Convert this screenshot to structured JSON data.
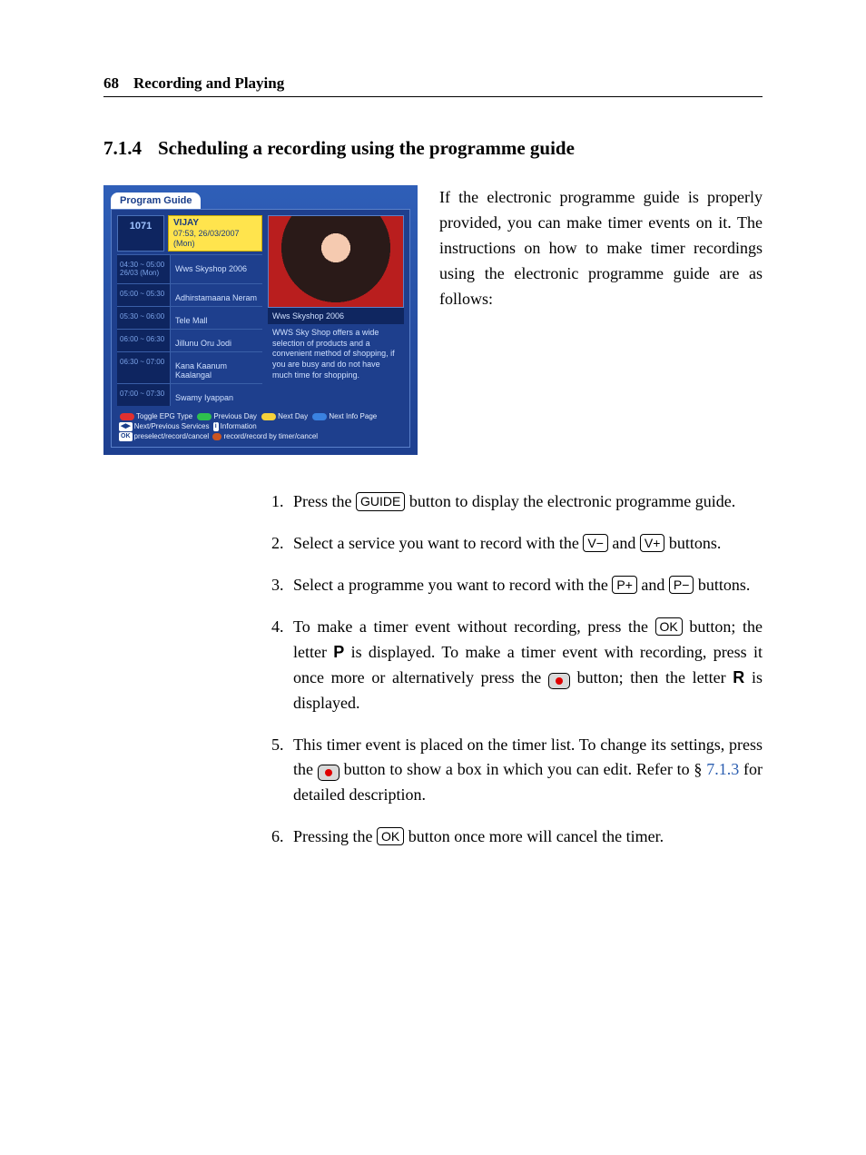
{
  "header": {
    "page_number": "68",
    "chapter_title": "Recording and Playing"
  },
  "section": {
    "number": "7.1.4",
    "title": "Scheduling a recording using the programme guide"
  },
  "intro_paragraph": "If the electronic programme guide is properly provided, you can make timer events on it. The instructions on how to make timer recordings using the electronic programme guide are as follows:",
  "epg": {
    "tab_title": "Program Guide",
    "channel_number": "1071",
    "channel_name": "VIJAY",
    "datetime": "07:53, 26/03/2007 (Mon)",
    "rows": [
      {
        "time": "04:30 ~ 05:00",
        "time_note": "26/03 (Mon)",
        "programme": "Wws Skyshop 2006"
      },
      {
        "time": "05:00 ~ 05:30",
        "time_note": "",
        "programme": "Adhirstamaana Neram"
      },
      {
        "time": "05:30 ~ 06:00",
        "time_note": "",
        "programme": "Tele Mall"
      },
      {
        "time": "06:00 ~ 06:30",
        "time_note": "",
        "programme": "Jillunu Oru Jodi"
      },
      {
        "time": "06:30 ~ 07:00",
        "time_note": "",
        "programme": "Kana Kaanum Kaalangal"
      },
      {
        "time": "07:00 ~ 07:30",
        "time_note": "",
        "programme": "Swamy Iyappan"
      }
    ],
    "preview_title": "Wws Skyshop 2006",
    "preview_desc": "WWS Sky Shop offers a wide selection of products and a convenient method of shopping, if you are busy and do not have much time for shopping.",
    "legend": {
      "red": "Toggle EPG Type",
      "green": "Previous Day",
      "yellow": "Next Day",
      "blue": "Next Info Page",
      "lr_key": "◀▶",
      "lr_label": "Next/Previous Services",
      "i_key": "i",
      "i_label": "Information",
      "ok_key": "OK",
      "ok_label": "preselect/record/cancel",
      "rec_label": "record/record by timer/cancel"
    }
  },
  "steps": {
    "s1a": "Press the ",
    "s1b": " button to display the electronic programme guide.",
    "s2a": "Select a service you want to record with the ",
    "s2b": " and ",
    "s2c": " buttons.",
    "s3a": "Select a programme you want to record with the ",
    "s3b": " and ",
    "s3c": " buttons.",
    "s4a": "To make a timer event without recording, press the ",
    "s4b": " button; the letter ",
    "s4c": " is displayed. To make a timer event with recording, press it once more or alternatively press the ",
    "s4d": " button; then the letter ",
    "s4e": " is displayed.",
    "s5a": "This timer event is placed on the timer list. To change its settings, press the ",
    "s5b": " button to show a box in which you can edit. Refer to § ",
    "s5c": " for detailed description.",
    "s6a": "Pressing the ",
    "s6b": " button once more will cancel the timer."
  },
  "keys": {
    "guide": "GUIDE",
    "v_minus": "V−",
    "v_plus": "V+",
    "p_plus": "P+",
    "p_minus": "P−",
    "ok": "OK"
  },
  "letters": {
    "P": "P",
    "R": "R"
  },
  "xref": "7.1.3"
}
